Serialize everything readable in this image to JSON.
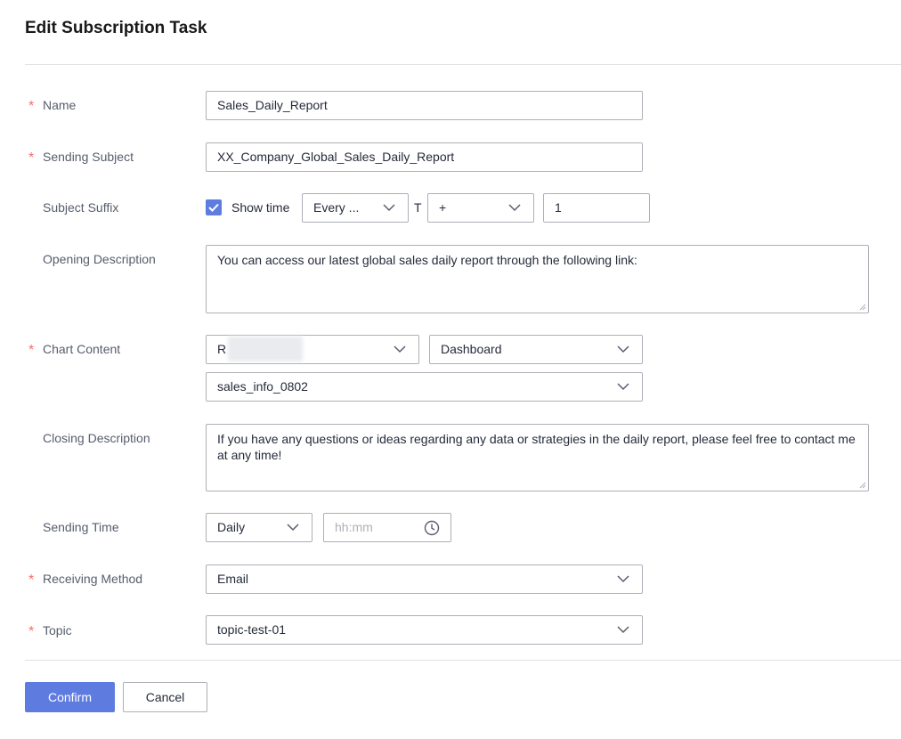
{
  "dialog": {
    "title": "Edit Subscription Task"
  },
  "required_mark": "*",
  "fields": {
    "name": {
      "label": "Name",
      "value": "Sales_Daily_Report"
    },
    "sending_subject": {
      "label": "Sending Subject",
      "value": "XX_Company_Global_Sales_Daily_Report"
    },
    "subject_suffix": {
      "label": "Subject Suffix",
      "show_time_label": "Show time",
      "show_time_checked": true,
      "period_value": "Every ...",
      "t_label": "T",
      "sign_value": "+",
      "offset_value": "1"
    },
    "opening_description": {
      "label": "Opening Description",
      "value": "You can access our latest global sales daily report through the following link:"
    },
    "chart_content": {
      "label": "Chart Content",
      "source_value": "R",
      "type_value": "Dashboard",
      "dashboard_value": "sales_info_0802"
    },
    "closing_description": {
      "label": "Closing Description",
      "value": "If you have any questions or ideas regarding any data or strategies in the daily report, please feel free to contact me at any time!"
    },
    "sending_time": {
      "label": "Sending Time",
      "frequency_value": "Daily",
      "time_placeholder": "hh:mm"
    },
    "receiving_method": {
      "label": "Receiving Method",
      "value": "Email"
    },
    "topic": {
      "label": "Topic",
      "value": "topic-test-01"
    }
  },
  "buttons": {
    "confirm": "Confirm",
    "cancel": "Cancel"
  },
  "colors": {
    "primary": "#5e7ce0",
    "required": "#f66f6a",
    "border": "#adb0b8"
  }
}
